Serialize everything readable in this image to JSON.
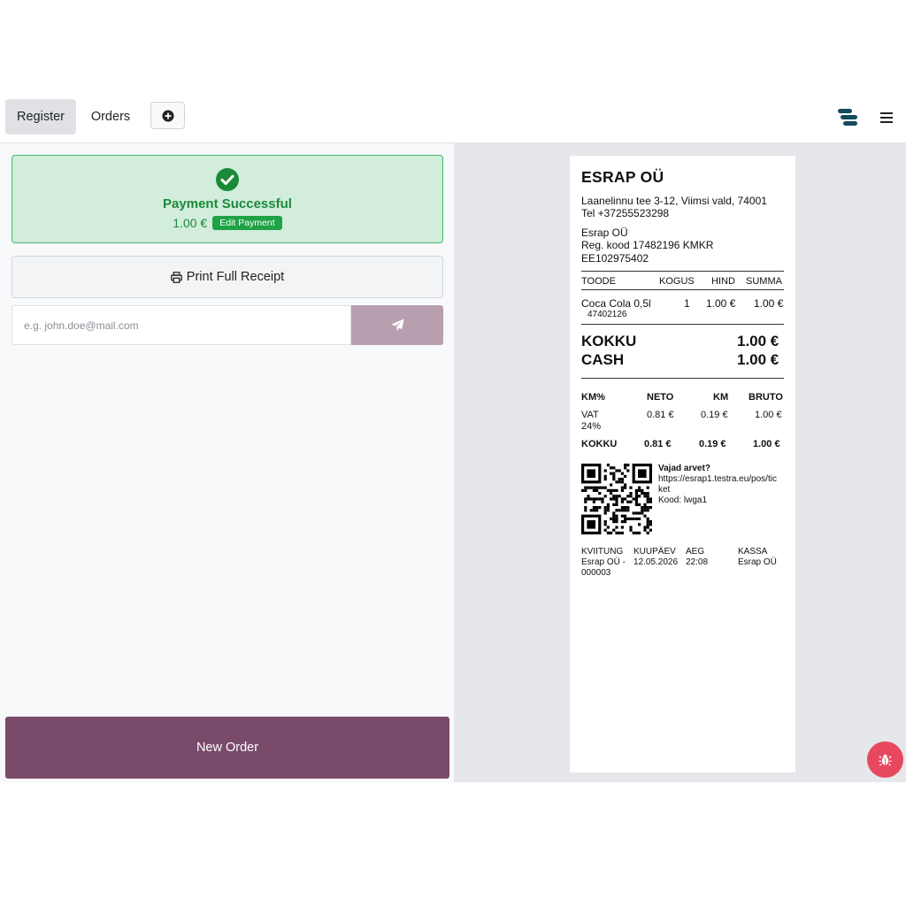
{
  "topbar": {
    "tabs": [
      {
        "label": "Register"
      },
      {
        "label": "Orders"
      }
    ],
    "icons": {
      "add": "plus-circle-icon",
      "server": "server-icon",
      "menu": "hamburger-menu-icon"
    }
  },
  "payment": {
    "title": "Payment Successful",
    "amount": "1.00 €",
    "edit_label": "Edit Payment",
    "status_color": "#1a8a39"
  },
  "actions": {
    "print_label": "Print Full Receipt",
    "email_placeholder": "e.g. john.doe@mail.com",
    "new_order_label": "New Order"
  },
  "receipt": {
    "company": "ESRAP OÜ",
    "address": "Laanelinnu tee 3-12, Viimsi vald, 74001",
    "phone": "Tel +37255523298",
    "legal_name": "Esrap OÜ",
    "reg_code": "Reg. kood 17482196 KMKR",
    "vat_number": "EE102975402",
    "columns": [
      "TOODE",
      "KOGUS",
      "HIND",
      "SUMMA"
    ],
    "items": [
      {
        "name": "Coca Cola 0,5l",
        "code": "47402126",
        "qty": "1",
        "price": "1.00 €",
        "sum": "1.00 €"
      }
    ],
    "total_label": "KOKKU",
    "total_value": "1.00 €",
    "cash_label": "CASH",
    "cash_value": "1.00 €",
    "vat_columns": [
      "KM%",
      "NETO",
      "KM",
      "BRUTO"
    ],
    "vat_rows": [
      {
        "rate_line1": "VAT",
        "rate_line2": "24%",
        "neto": "0.81 €",
        "km": "0.19 €",
        "bruto": "1.00 €"
      }
    ],
    "vat_total": {
      "label": "KOKKU",
      "neto": "0.81 €",
      "km": "0.19 €",
      "bruto": "1.00 €"
    },
    "invoice": {
      "title": "Vajad arvet?",
      "url_line1": "https://esrap1.testra.eu/pos/tic",
      "url_line2": "ket",
      "code": "Kood: lwga1"
    },
    "footer": {
      "headers": [
        "KVIITUNG",
        "KUUPÄEV",
        "AEG",
        "KASSA"
      ],
      "receipt_no_line1": "Esrap OÜ -",
      "receipt_no_line2": "000003",
      "date": "12.05.2026",
      "time": "22:08",
      "register": "Esrap OÜ"
    }
  },
  "colors": {
    "accent": "#7a4a6b",
    "send_button": "#b89fb0",
    "success_bg": "#d2eddb",
    "success_green": "#1fa146",
    "bug_button": "#e8485f"
  }
}
